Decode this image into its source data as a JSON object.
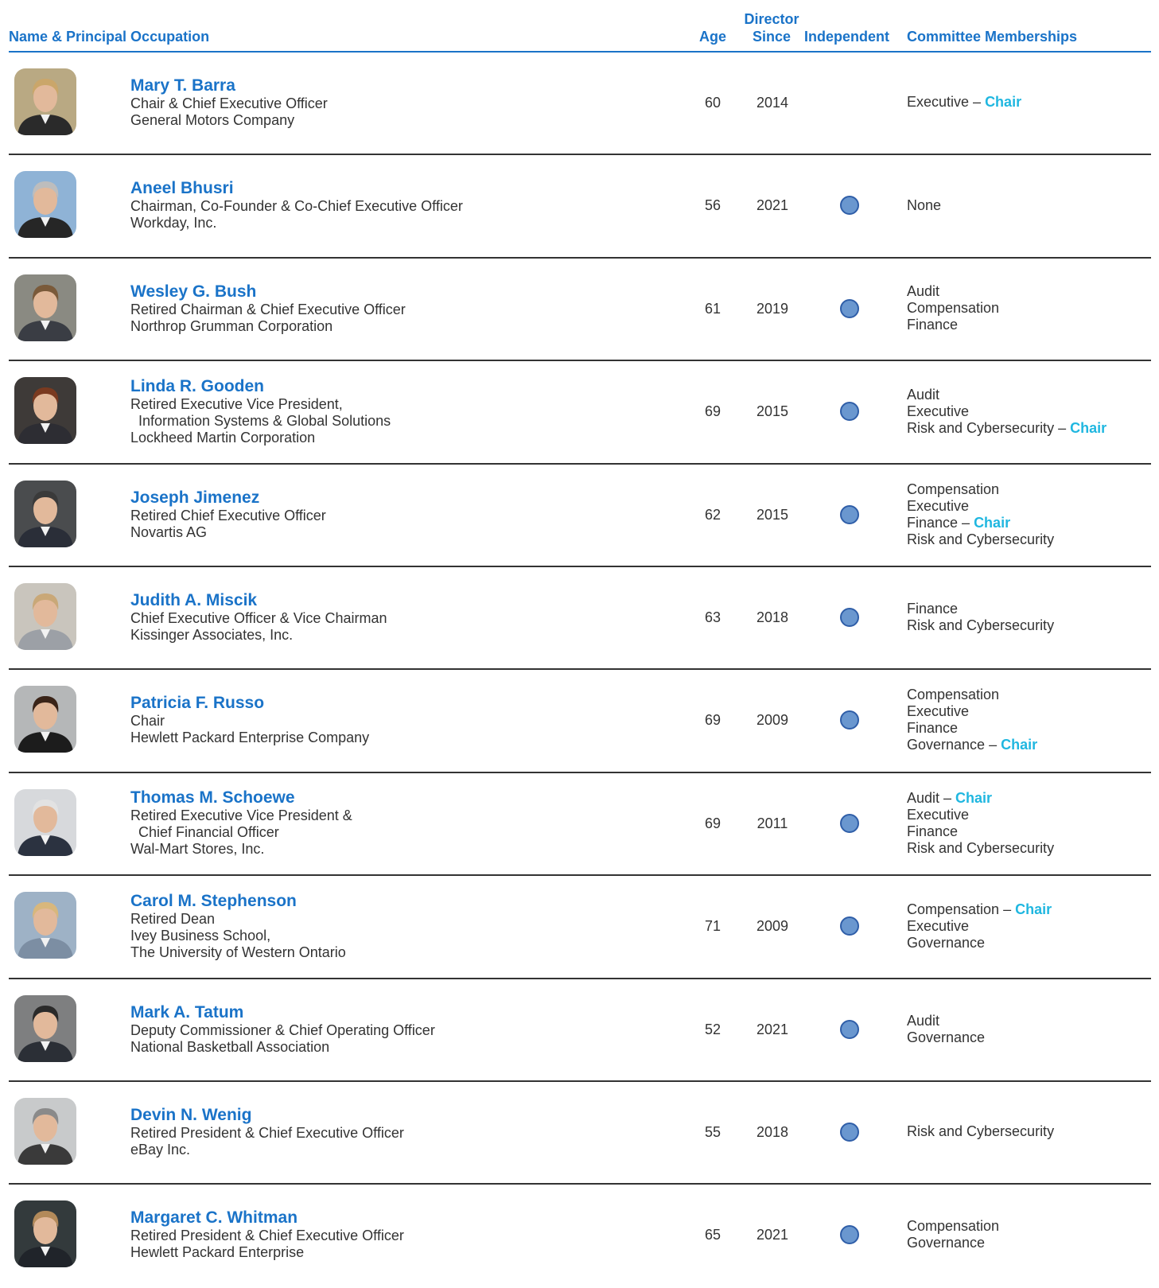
{
  "header": {
    "name_occupation": "Name & Principal Occupation",
    "age": "Age",
    "director_since_line1": "Director",
    "director_since_line2": "Since",
    "independent": "Independent",
    "committees": "Committee Memberships"
  },
  "colors": {
    "heading_blue": "#1a73c8",
    "chair_cyan": "#20b7e0",
    "independent_dot": "#6a97cf",
    "body_text": "#333333"
  },
  "directors": [
    {
      "name": "Mary T. Barra",
      "occupation": [
        "Chair & Chief Executive Officer",
        "General Motors Company"
      ],
      "age": "60",
      "since": "2014",
      "independent": false,
      "committees": [
        {
          "name": "Executive",
          "chair": true
        }
      ]
    },
    {
      "name": "Aneel Bhusri",
      "occupation": [
        "Chairman, Co-Founder & Co-Chief Executive Officer",
        "Workday, Inc."
      ],
      "age": "56",
      "since": "2021",
      "independent": true,
      "committees": [
        {
          "name": "None",
          "chair": false
        }
      ]
    },
    {
      "name": "Wesley G. Bush",
      "occupation": [
        "Retired Chairman & Chief Executive Officer",
        "Northrop Grumman Corporation"
      ],
      "age": "61",
      "since": "2019",
      "independent": true,
      "committees": [
        {
          "name": "Audit",
          "chair": false
        },
        {
          "name": "Compensation",
          "chair": false
        },
        {
          "name": "Finance",
          "chair": false
        }
      ]
    },
    {
      "name": "Linda R. Gooden",
      "occupation": [
        "Retired Executive Vice President,",
        "  Information Systems & Global Solutions",
        "Lockheed Martin Corporation"
      ],
      "age": "69",
      "since": "2015",
      "independent": true,
      "committees": [
        {
          "name": "Audit",
          "chair": false
        },
        {
          "name": "Executive",
          "chair": false
        },
        {
          "name": "Risk and Cybersecurity",
          "chair": true
        }
      ]
    },
    {
      "name": "Joseph Jimenez",
      "occupation": [
        "Retired Chief Executive Officer",
        "Novartis AG"
      ],
      "age": "62",
      "since": "2015",
      "independent": true,
      "committees": [
        {
          "name": "Compensation",
          "chair": false
        },
        {
          "name": "Executive",
          "chair": false
        },
        {
          "name": "Finance",
          "chair": true
        },
        {
          "name": "Risk and Cybersecurity",
          "chair": false
        }
      ]
    },
    {
      "name": "Judith A. Miscik",
      "occupation": [
        "Chief Executive Officer & Vice Chairman",
        "Kissinger Associates, Inc."
      ],
      "age": "63",
      "since": "2018",
      "independent": true,
      "committees": [
        {
          "name": "Finance",
          "chair": false
        },
        {
          "name": "Risk and Cybersecurity",
          "chair": false
        }
      ]
    },
    {
      "name": "Patricia F. Russo",
      "occupation": [
        "Chair",
        "Hewlett Packard Enterprise Company"
      ],
      "age": "69",
      "since": "2009",
      "independent": true,
      "committees": [
        {
          "name": "Compensation",
          "chair": false
        },
        {
          "name": "Executive",
          "chair": false
        },
        {
          "name": "Finance",
          "chair": false
        },
        {
          "name": "Governance",
          "chair": true
        }
      ]
    },
    {
      "name": "Thomas M. Schoewe",
      "occupation": [
        "Retired Executive Vice President &",
        "  Chief Financial Officer",
        "Wal-Mart Stores, Inc."
      ],
      "age": "69",
      "since": "2011",
      "independent": true,
      "committees": [
        {
          "name": "Audit",
          "chair": true
        },
        {
          "name": "Executive",
          "chair": false
        },
        {
          "name": "Finance",
          "chair": false
        },
        {
          "name": "Risk and Cybersecurity",
          "chair": false
        }
      ]
    },
    {
      "name": "Carol M. Stephenson",
      "occupation": [
        "Retired Dean",
        "Ivey Business School,",
        "The University of Western Ontario"
      ],
      "age": "71",
      "since": "2009",
      "independent": true,
      "committees": [
        {
          "name": "Compensation",
          "chair": true
        },
        {
          "name": "Executive",
          "chair": false
        },
        {
          "name": "Governance",
          "chair": false
        }
      ]
    },
    {
      "name": "Mark A. Tatum",
      "occupation": [
        "Deputy Commissioner & Chief Operating Officer",
        "National Basketball Association"
      ],
      "age": "52",
      "since": "2021",
      "independent": true,
      "committees": [
        {
          "name": "Audit",
          "chair": false
        },
        {
          "name": "Governance",
          "chair": false
        }
      ]
    },
    {
      "name": "Devin N. Wenig",
      "occupation": [
        "Retired President & Chief Executive Officer",
        "eBay Inc."
      ],
      "age": "55",
      "since": "2018",
      "independent": true,
      "committees": [
        {
          "name": "Risk and Cybersecurity",
          "chair": false
        }
      ]
    },
    {
      "name": "Margaret C. Whitman",
      "occupation": [
        "Retired President & Chief Executive Officer",
        "Hewlett Packard Enterprise"
      ],
      "age": "65",
      "since": "2021",
      "independent": true,
      "committees": [
        {
          "name": "Compensation",
          "chair": false
        },
        {
          "name": "Governance",
          "chair": false
        }
      ]
    }
  ],
  "chair_separator": " – ",
  "chair_label": "Chair"
}
